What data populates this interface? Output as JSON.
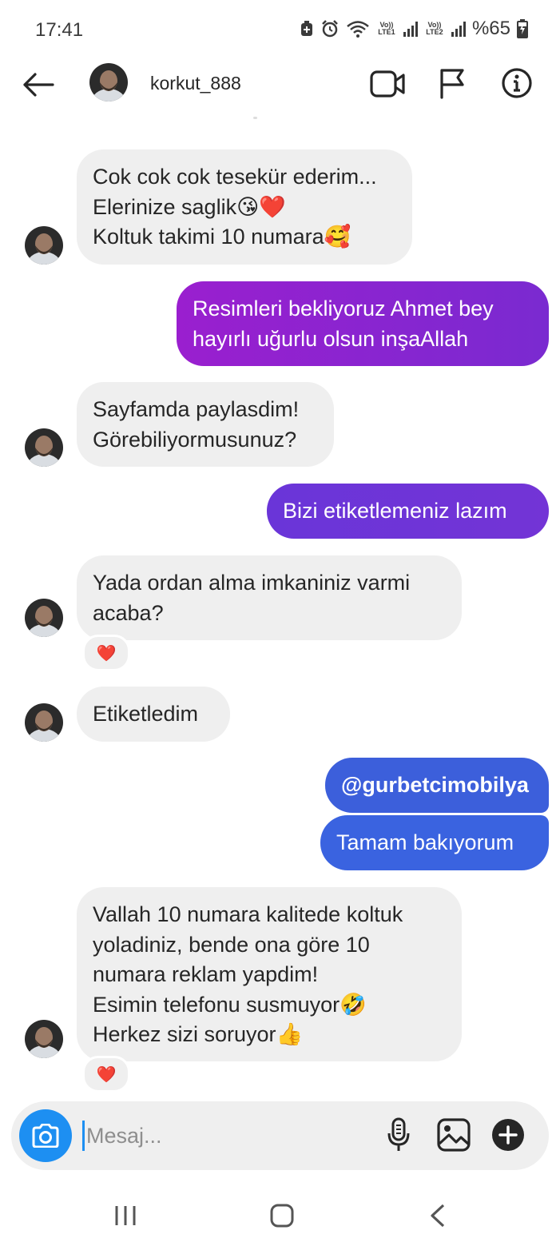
{
  "status": {
    "time": "17:41",
    "battery": "%65",
    "sim1": "Vo)) LTE1",
    "sim2": "Vo)) LTE2"
  },
  "header": {
    "username": "korkut_888",
    "icons": [
      "back-arrow-icon",
      "video-call-icon",
      "flag-icon",
      "info-icon"
    ]
  },
  "messages": [
    {
      "side": "in",
      "text": "Cok cok cok tesekür ederim...\nElerinize saglik😘❤️\nKoltuk takimi 10 numara🥰"
    },
    {
      "side": "out",
      "text": "Resimleri bekliyoruz Ahmet bey\nhayırlı uğurlu olsun inşaAllah",
      "color": "#8a22cf"
    },
    {
      "side": "in",
      "text": "Sayfamda paylasdim!\nGörebiliyormusunuz?"
    },
    {
      "side": "out",
      "text": "Bizi etiketlemeniz lazım",
      "color": "#6f35d6"
    },
    {
      "side": "in",
      "text": "Yada ordan alma imkaniniz varmi\nacaba?",
      "reaction": "❤️"
    },
    {
      "side": "in",
      "text": "Etiketledim"
    },
    {
      "side": "out",
      "text": "@gurbetcimobilya",
      "color": "#3c5fdb"
    },
    {
      "side": "out",
      "text": "Tamam bakıyorum",
      "color": "#3a63e0"
    },
    {
      "side": "in",
      "text": "Vallah 10 numara kalitede koltuk\nyoladiniz, bende ona göre 10\nnumara reklam yapdim!\nEsimin telefonu susmuyor🤣\nHerkez sizi soruyor👍",
      "reaction": "❤️"
    }
  ],
  "composer": {
    "placeholder": "Mesaj...",
    "icons": [
      "camera-icon",
      "microphone-icon",
      "gallery-icon",
      "plus-icon"
    ]
  },
  "navbar": {
    "icons": [
      "recent-apps-icon",
      "home-icon",
      "back-icon"
    ]
  },
  "colors": {
    "incoming_bubble": "#efefef",
    "accent_blue": "#1d8ff2"
  }
}
